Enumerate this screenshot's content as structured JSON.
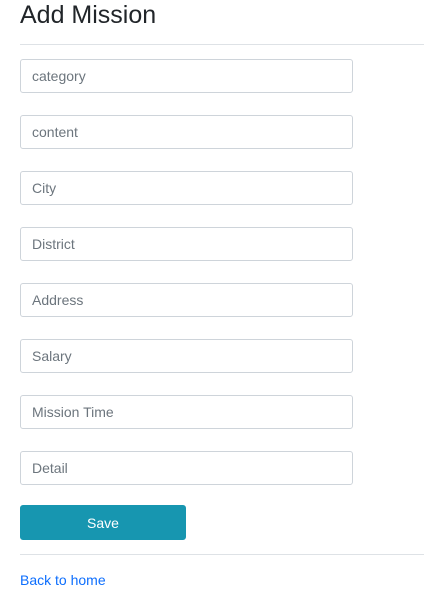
{
  "page": {
    "title": "Add Mission"
  },
  "form": {
    "fields": [
      {
        "name": "category",
        "placeholder": "category",
        "value": ""
      },
      {
        "name": "content",
        "placeholder": "content",
        "value": ""
      },
      {
        "name": "city",
        "placeholder": "City",
        "value": ""
      },
      {
        "name": "district",
        "placeholder": "District",
        "value": ""
      },
      {
        "name": "address",
        "placeholder": "Address",
        "value": ""
      },
      {
        "name": "salary",
        "placeholder": "Salary",
        "value": ""
      },
      {
        "name": "mission_time",
        "placeholder": "Mission Time",
        "value": ""
      },
      {
        "name": "detail",
        "placeholder": "Detail",
        "value": ""
      }
    ],
    "save_label": "Save"
  },
  "footer": {
    "back_link_label": "Back to home"
  },
  "colors": {
    "button_bg": "#1796b0",
    "link": "#0d6efd",
    "border": "#ced4da",
    "divider": "#dee2e6"
  }
}
